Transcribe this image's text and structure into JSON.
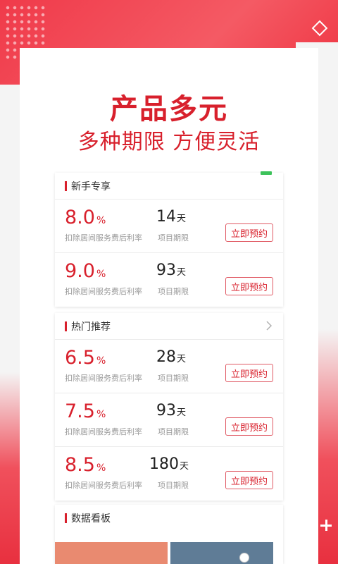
{
  "headline": "产品多元",
  "subline": "多种期限 方便灵活",
  "sections": [
    {
      "title": "新手专享",
      "items": [
        {
          "rate": "8.0",
          "rate_unit": "%",
          "rate_label": "扣除居间服务费后利率",
          "term": "14",
          "term_unit": "天",
          "term_label": "项目期限",
          "button": "立即预约"
        },
        {
          "rate": "9.0",
          "rate_unit": "%",
          "rate_label": "扣除居间服务费后利率",
          "term": "93",
          "term_unit": "天",
          "term_label": "项目期限",
          "button": "立即预约"
        }
      ]
    },
    {
      "title": "热门推荐",
      "items": [
        {
          "rate": "6.5",
          "rate_unit": "%",
          "rate_label": "扣除居间服务费后利率",
          "term": "28",
          "term_unit": "天",
          "term_label": "项目期限",
          "button": "立即预约"
        },
        {
          "rate": "7.5",
          "rate_unit": "%",
          "rate_label": "扣除居间服务费后利率",
          "term": "93",
          "term_unit": "天",
          "term_label": "项目期限",
          "button": "立即预约"
        },
        {
          "rate": "8.5",
          "rate_unit": "%",
          "rate_label": "扣除居间服务费后利率",
          "term": "180",
          "term_unit": "天",
          "term_label": "项目期限",
          "button": "立即预约"
        }
      ]
    },
    {
      "title": "数据看板"
    }
  ],
  "icons": {
    "corner": "diamond-icon",
    "more": "chevron-right-icon",
    "corner_plus": "plus-icon"
  },
  "colors": {
    "brand_red": "#d8202c",
    "status_green": "#3cc25a"
  }
}
